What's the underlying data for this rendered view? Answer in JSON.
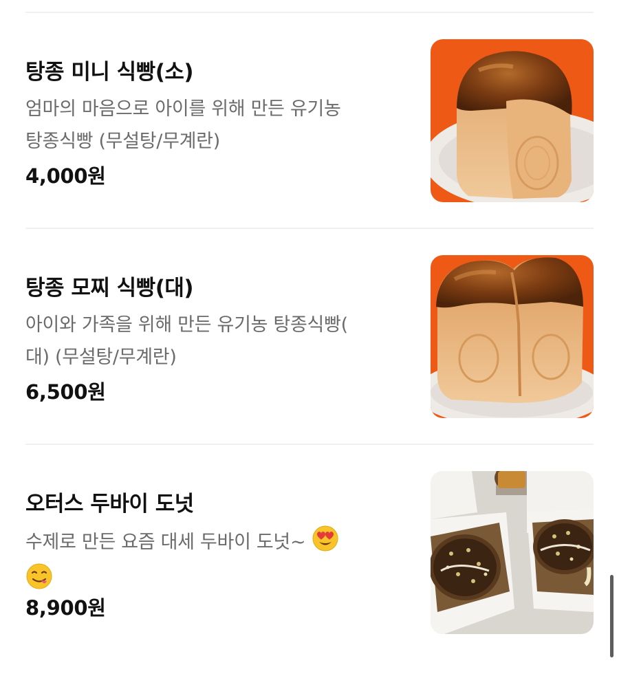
{
  "menu_items": [
    {
      "name": "탕종 미니 식빵(소)",
      "description": "엄마의 마음으로 아이를 위해 만든 유기농 탕종식빵 (무설탕/무계란)",
      "description_lines": [
        "엄마의 마음으로 아이를 위해 만든 유기농",
        "탕종식빵 (무설탕/무계란)"
      ],
      "price": "4,000원",
      "image": "small-milk-bread-loaf-photo"
    },
    {
      "name": "탕종 모찌 식빵(대)",
      "description": "아이와 가족을 위해 만든 유기농 탕종식빵(대) (무설탕/무계란)",
      "description_lines": [
        "아이와 가족을 위해 만든 유기농 탕종식빵(",
        "대) (무설탕/무계란)"
      ],
      "price": "6,500원",
      "image": "large-mochi-bread-loaf-photo"
    },
    {
      "name": "오터스 두바이 도넛",
      "description": "수제로 만든 요즘 대세 두바이 도넛~",
      "description_lines": [
        "수제로 만든 요즘 대세 두바이 도넛~"
      ],
      "emojis": [
        "heart-eyes-emoji",
        "yum-face-emoji"
      ],
      "price": "8,900원",
      "image": "dubai-donut-in-takeout-box-photo"
    }
  ],
  "colors": {
    "title_text": "#111111",
    "description_text": "#6b6b6b",
    "divider": "#f0f0f0",
    "photo_background_orange": "#f2661f"
  }
}
